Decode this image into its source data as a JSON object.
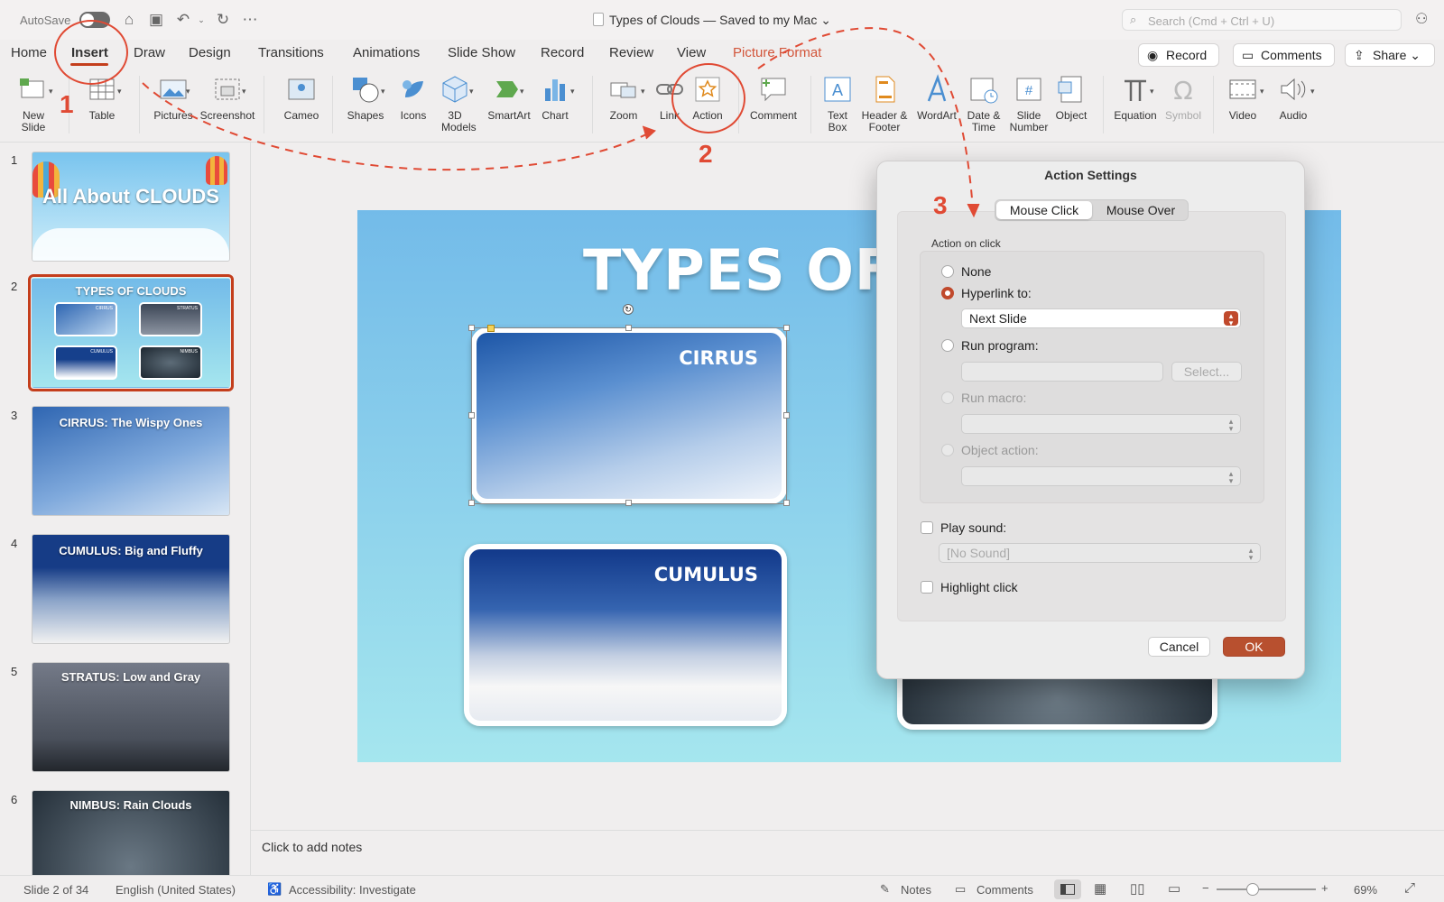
{
  "titlebar": {
    "autosave_label": "AutoSave",
    "doc_title": "Types of Clouds — Saved to my Mac ⌄",
    "search_placeholder": "Search (Cmd + Ctrl + U)"
  },
  "tabs": [
    "Home",
    "Insert",
    "Draw",
    "Design",
    "Transitions",
    "Animations",
    "Slide Show",
    "Record",
    "Review",
    "View",
    "Picture Format"
  ],
  "tab_buttons": {
    "record": "Record",
    "comments": "Comments",
    "share": "Share"
  },
  "ribbon": {
    "new_slide": "New Slide",
    "table": "Table",
    "pictures": "Pictures",
    "screenshot": "Screenshot",
    "cameo": "Cameo",
    "shapes": "Shapes",
    "icons": "Icons",
    "models": "3D Models",
    "smartart": "SmartArt",
    "chart": "Chart",
    "zoom": "Zoom",
    "link": "Link",
    "action": "Action",
    "comment": "Comment",
    "textbox": "Text Box",
    "header": "Header & Footer",
    "wordart": "WordArt",
    "datetime": "Date & Time",
    "slidenum": "Slide Number",
    "object": "Object",
    "equation": "Equation",
    "symbol": "Symbol",
    "video": "Video",
    "audio": "Audio"
  },
  "thumbnails": [
    {
      "num": "1",
      "title": "All About CLOUDS"
    },
    {
      "num": "2",
      "title": "TYPES OF CLOUDS",
      "mini": [
        "CIRRUS",
        "STRATUS",
        "CUMULUS",
        "NIMBUS"
      ]
    },
    {
      "num": "3",
      "title": "CIRRUS: The Wispy Ones"
    },
    {
      "num": "4",
      "title": "CUMULUS: Big and Fluffy"
    },
    {
      "num": "5",
      "title": "STRATUS: Low and Gray"
    },
    {
      "num": "6",
      "title": "NIMBUS: Rain Clouds"
    }
  ],
  "slide": {
    "title": "TYPES OF",
    "cards": [
      "CIRRUS",
      "CUMULUS"
    ]
  },
  "notes": "Click to add notes",
  "status": {
    "slide": "Slide 2 of 34",
    "lang": "English (United States)",
    "access": "Accessibility: Investigate",
    "notes": "Notes",
    "comments": "Comments",
    "zoom": "69%"
  },
  "dialog": {
    "title": "Action Settings",
    "tabs": [
      "Mouse Click",
      "Mouse Over"
    ],
    "section": "Action on click",
    "options": [
      "None",
      "Hyperlink to:",
      "Run program:",
      "Run macro:",
      "Object action:"
    ],
    "hyperlink_value": "Next Slide",
    "select_btn": "Select...",
    "play_sound": "Play sound:",
    "sound_value": "[No Sound]",
    "highlight": "Highlight click",
    "cancel": "Cancel",
    "ok": "OK"
  },
  "annotations": [
    "1",
    "2",
    "3"
  ],
  "colors": {
    "accent": "#c43e1c",
    "annotation": "#e04a34"
  }
}
